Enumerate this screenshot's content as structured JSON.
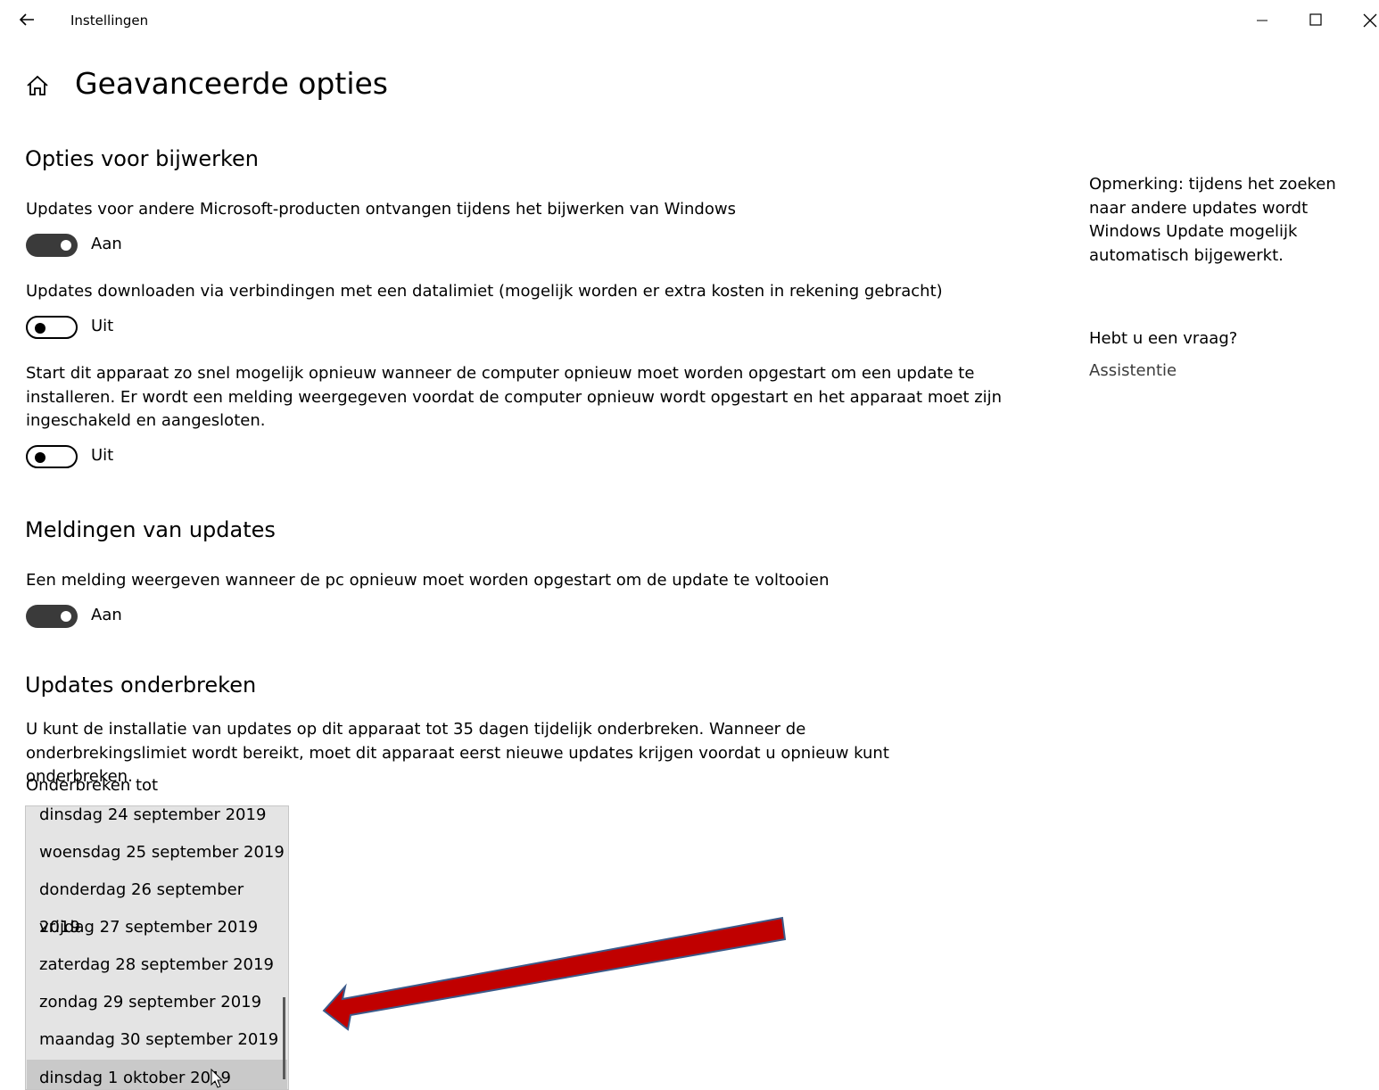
{
  "window": {
    "app_title": "Instellingen",
    "controls": {
      "minimize": "minimize",
      "maximize": "maximize",
      "close": "close"
    }
  },
  "page": {
    "title": "Geavanceerde opties"
  },
  "update_options": {
    "title": "Opties voor bijwerken",
    "settings": [
      {
        "label": "Updates voor andere Microsoft-producten ontvangen tijdens het bijwerken van Windows",
        "state_label": "Aan",
        "on": true
      },
      {
        "label": "Updates downloaden via verbindingen met een datalimiet (mogelijk worden er extra kosten in rekening gebracht)",
        "state_label": "Uit",
        "on": false
      },
      {
        "label": "Start dit apparaat zo snel mogelijk opnieuw wanneer de computer opnieuw moet worden opgestart om een update te installeren. Er wordt een melding weergegeven voordat de computer opnieuw wordt opgestart en het apparaat moet zijn ingeschakeld en aangesloten.",
        "state_label": "Uit",
        "on": false
      }
    ]
  },
  "notifications": {
    "title": "Meldingen van updates",
    "setting": {
      "label": "Een melding weergeven wanneer de pc opnieuw moet worden opgestart om de update te voltooien",
      "state_label": "Aan",
      "on": true
    }
  },
  "pause": {
    "title": "Updates onderbreken",
    "description": "U kunt de installatie van updates op dit apparaat tot 35 dagen tijdelijk onderbreken. Wanneer de onderbrekingslimiet wordt bereikt, moet dit apparaat eerst nieuwe updates krijgen voordat u opnieuw kunt onderbreken.",
    "pause_until_label": "Onderbreken tot",
    "options": [
      "dinsdag 24 september 2019",
      "woensdag 25 september 2019",
      "donderdag 26 september 2019",
      "vrijdag 27 september 2019",
      "zaterdag 28 september 2019",
      "zondag 29 september 2019",
      "maandag 30 september 2019",
      "dinsdag 1 oktober 2019"
    ],
    "hovered_option": "dinsdag 1 oktober 2019"
  },
  "side_panel": {
    "note": "Opmerking: tijdens het zoeken naar andere updates wordt Windows Update mogelijk automatisch bijgewerkt.",
    "help_title": "Hebt u een vraag?",
    "help_link": "Assistentie"
  },
  "annotation": {
    "arrow_color": "#c00000",
    "arrow_outline": "#3b5a8a"
  },
  "icons": [
    "back-arrow-icon",
    "home-icon",
    "minimize-icon",
    "maximize-icon",
    "close-icon",
    "mouse-cursor-icon"
  ]
}
